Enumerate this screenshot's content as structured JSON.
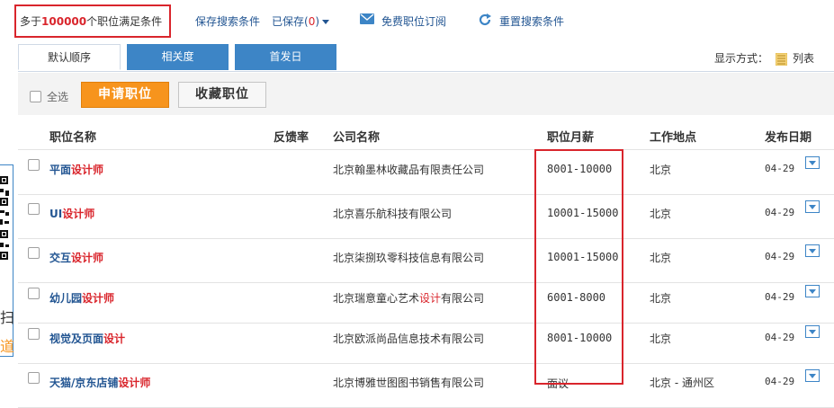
{
  "top": {
    "count_prefix": "多于",
    "count_number": "100000",
    "count_suffix": "个职位满足条件",
    "save_search": "保存搜索条件",
    "saved_prefix": "已保存(",
    "saved_count": "0",
    "saved_suffix": ")",
    "subscribe": "免费职位订阅",
    "reset": "重置搜索条件"
  },
  "tabs": [
    {
      "label": "默认顺序",
      "active": true
    },
    {
      "label": "相关度",
      "active": false
    },
    {
      "label": "首发日",
      "active": false
    }
  ],
  "display_mode": {
    "label": "显示方式：",
    "value": "列表"
  },
  "actions": {
    "select_all": "全选",
    "apply": "申请职位",
    "favorite": "收藏职位"
  },
  "columns": {
    "title": "职位名称",
    "feedback": "反馈率",
    "company": "公司名称",
    "salary": "职位月薪",
    "location": "工作地点",
    "date": "发布日期"
  },
  "jobs": [
    {
      "title_pre": "平面",
      "title_hl": "设计师",
      "title_post": "",
      "company_pre": "北京翰墨林收藏品有限责任公司",
      "company_hl": "",
      "company_post": "",
      "salary": "8001-10000",
      "location": "北京",
      "date": "04-29"
    },
    {
      "title_pre": "UI",
      "title_hl": "设计师",
      "title_post": "",
      "company_pre": "北京喜乐航科技有限公司",
      "company_hl": "",
      "company_post": "",
      "salary": "10001-15000",
      "location": "北京",
      "date": "04-29"
    },
    {
      "title_pre": "交互",
      "title_hl": "设计师",
      "title_post": "",
      "company_pre": "北京柒捌玖零科技信息有限公司",
      "company_hl": "",
      "company_post": "",
      "salary": "10001-15000",
      "location": "北京",
      "date": "04-29"
    },
    {
      "title_pre": "幼儿园",
      "title_hl": "设计师",
      "title_post": "",
      "company_pre": "北京瑞意童心艺术",
      "company_hl": "设计",
      "company_post": "有限公司",
      "salary": "6001-8000",
      "location": "北京",
      "date": "04-29"
    },
    {
      "title_pre": "视觉及页面",
      "title_hl": "设计",
      "title_post": "",
      "company_pre": "北京欧派尚品信息技术有限公司",
      "company_hl": "",
      "company_post": "",
      "salary": "8001-10000",
      "location": "北京",
      "date": "04-29"
    },
    {
      "title_pre": "天猫/京东店铺",
      "title_hl": "设计师",
      "title_post": "",
      "company_pre": "北京博雅世图图书销售有限公司",
      "company_hl": "",
      "company_post": "",
      "salary": "面议",
      "location": "北京 - 通州区",
      "date": "04-29"
    }
  ],
  "side_panel": {
    "text1": "扫",
    "text2": "道"
  },
  "colors": {
    "accent_blue": "#3d85c6",
    "link_blue": "#225592",
    "highlight_red": "#d9252c",
    "orange": "#f7941d"
  }
}
